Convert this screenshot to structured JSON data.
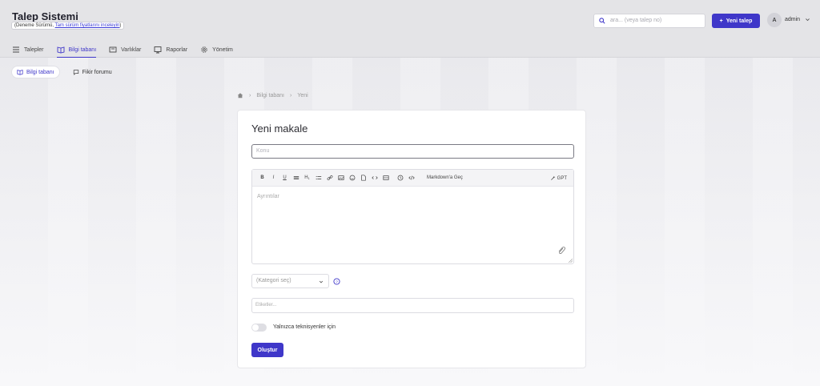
{
  "header": {
    "app_title": "Talep Sistemi",
    "trial_prefix": "(Deneme Sürümü, ",
    "trial_link": "Tam sürüm fiyatlarını inceleyin",
    "trial_suffix": ")",
    "search_placeholder": "ara... (veya talep no)",
    "new_ticket_label": "Yeni talep",
    "avatar_initial": "A",
    "user_name": "admin"
  },
  "nav": {
    "items": [
      {
        "label": "Talepler",
        "icon": "list-icon"
      },
      {
        "label": "Bilgi tabanı",
        "icon": "book-icon"
      },
      {
        "label": "Varlıklar",
        "icon": "asset-icon"
      },
      {
        "label": "Raporlar",
        "icon": "report-icon"
      },
      {
        "label": "Yönetim",
        "icon": "gear-icon"
      }
    ],
    "active": "Bilgi tabanı"
  },
  "subnav": {
    "items": [
      {
        "label": "Bilgi tabanı",
        "icon": "book-icon"
      },
      {
        "label": "Fikir forumu",
        "icon": "chat-icon"
      }
    ]
  },
  "breadcrumb": {
    "items": [
      "Bilgi tabanı",
      "Yeni"
    ]
  },
  "form": {
    "title": "Yeni makale",
    "subject_placeholder": "Konu",
    "details_placeholder": "Ayrıntılar",
    "markdown_toggle": "Markdown'a Geç",
    "gpt_label": "GPT",
    "category_placeholder": "(Kategori seç)",
    "tags_placeholder": "Etiketler...",
    "technicians_only_label": "Yalnızca teknisyenler için",
    "create_label": "Oluştur"
  },
  "colors": {
    "accent": "#3f37c9"
  }
}
